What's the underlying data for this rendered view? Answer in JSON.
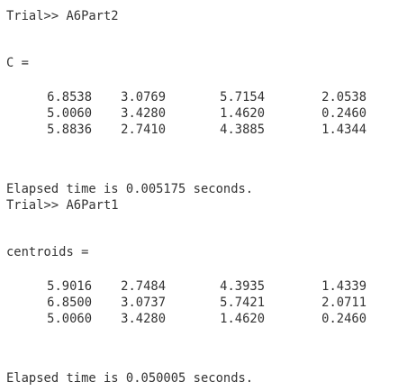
{
  "block1": {
    "prompt": "Trial>> A6Part2",
    "var_label": "C =",
    "rows": [
      [
        "6.8538",
        "3.0769",
        "5.7154",
        "2.0538"
      ],
      [
        "5.0060",
        "3.4280",
        "1.4620",
        "0.2460"
      ],
      [
        "5.8836",
        "2.7410",
        "4.3885",
        "1.4344"
      ]
    ],
    "elapsed": "Elapsed time is 0.005175 seconds."
  },
  "block2": {
    "prompt": "Trial>> A6Part1",
    "var_label": "centroids =",
    "rows": [
      [
        "5.9016",
        "2.7484",
        "4.3935",
        "1.4339"
      ],
      [
        "6.8500",
        "3.0737",
        "5.7421",
        "2.0711"
      ],
      [
        "5.0060",
        "3.4280",
        "1.4620",
        "0.2460"
      ]
    ],
    "elapsed": "Elapsed time is 0.050005 seconds."
  }
}
